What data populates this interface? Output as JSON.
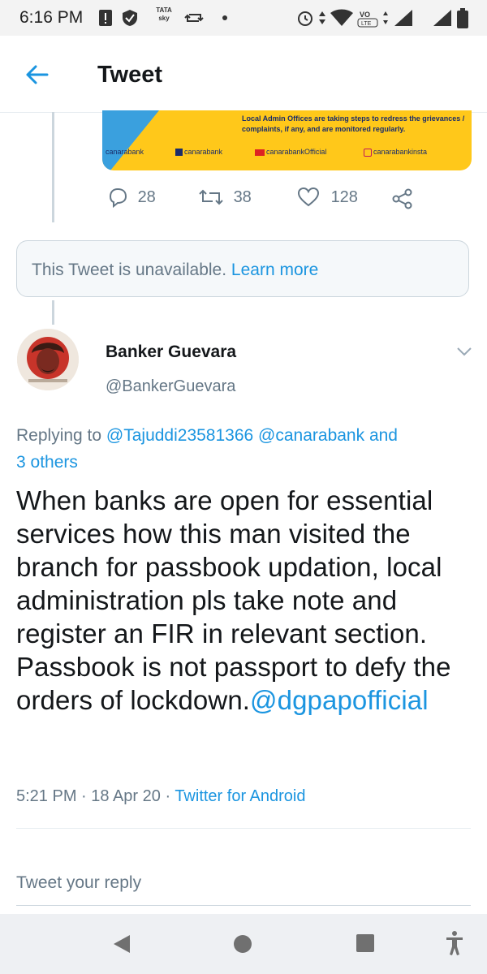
{
  "status_bar": {
    "time": "6:16 PM",
    "carrier_badge": "TATA sky"
  },
  "header": {
    "title": "Tweet"
  },
  "quoted_banner": {
    "text": "Local Admin Offices are taking steps to redress the grievances / complaints, if any, and are monitored regularly.",
    "social": [
      "canarabank",
      "canarabank",
      "canarabankOfficial",
      "canarabankinsta"
    ]
  },
  "actions": {
    "replies": "28",
    "retweets": "38",
    "likes": "128"
  },
  "unavailable": {
    "text": "This Tweet is unavailable.",
    "link": "Learn more"
  },
  "tweet": {
    "name": "Banker Guevara",
    "handle": "@BankerGuevara",
    "replying_prefix": "Replying to",
    "replying_mentions": "@Tajuddi23581366 @canarabank",
    "replying_suffix": "and",
    "replying_others": "3 others",
    "body": "When banks are open for essential services how this man visited the branch for passbook updation, local administration pls take note and register an FIR in relevant section. Passbook is not passport to defy the orders of lockdown.",
    "body_mention": "@dgpapofficial",
    "time": "5:21 PM",
    "date": "18 Apr 20",
    "source": "Twitter for Android"
  },
  "reply_box": {
    "placeholder": "Tweet your reply"
  },
  "colors": {
    "accent": "#1b95e0",
    "secondary_text": "#657786",
    "banner_yellow": "#ffc81a"
  }
}
